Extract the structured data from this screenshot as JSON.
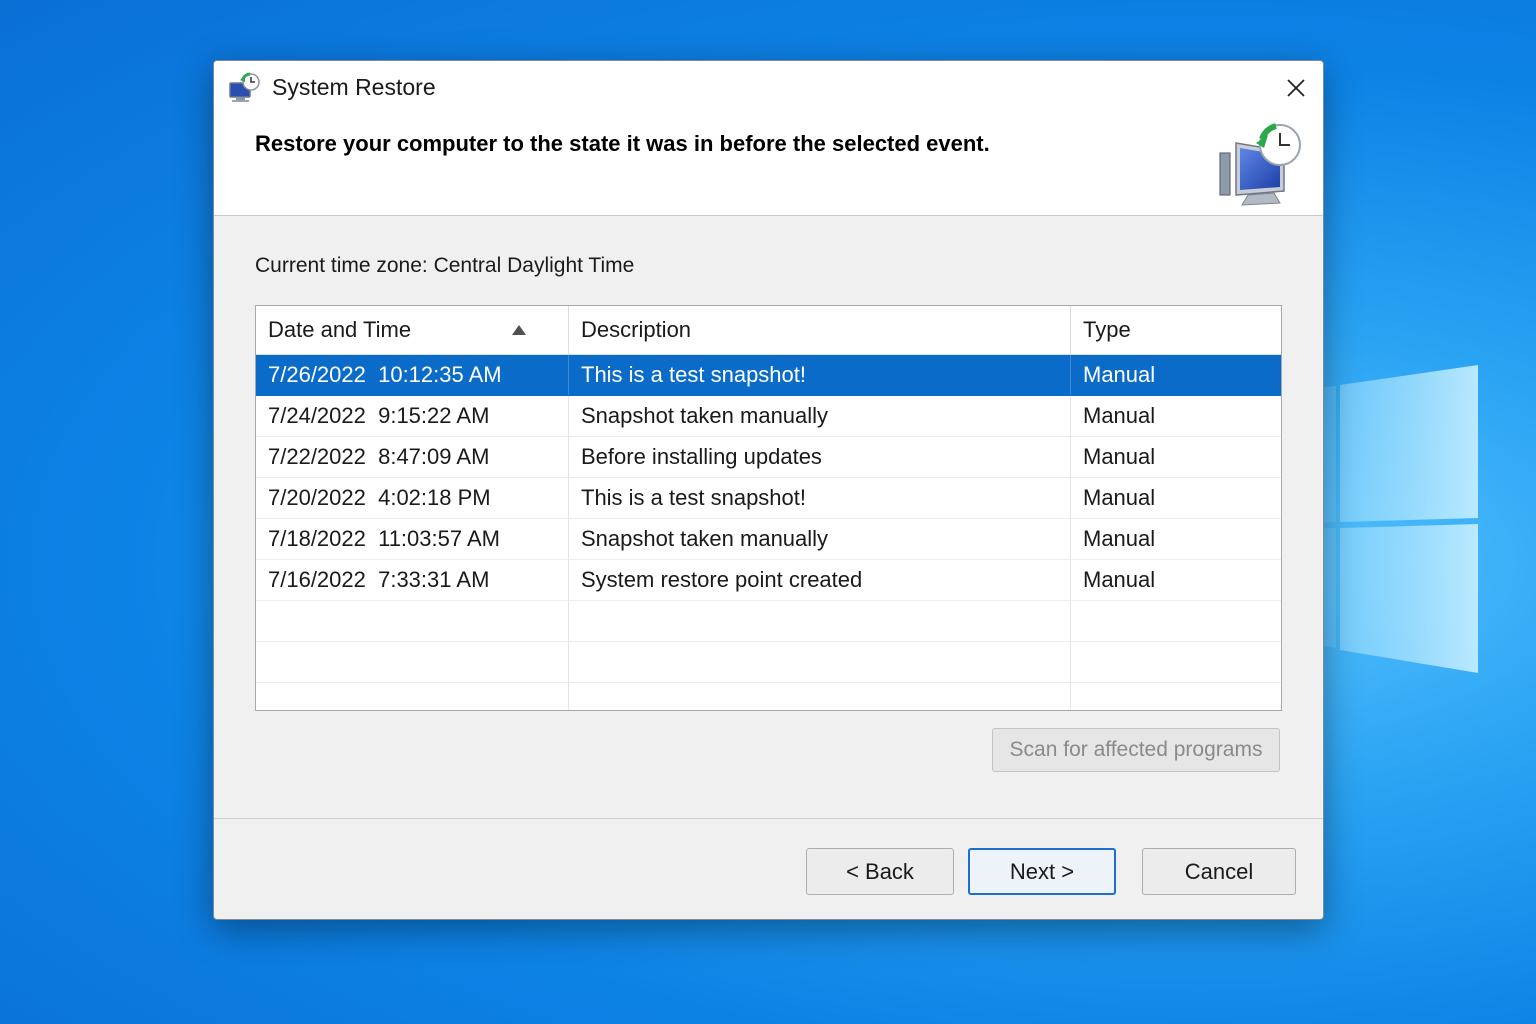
{
  "window": {
    "title": "System Restore",
    "heading": "Restore your computer to the state it was in before the selected event.",
    "timezone": "Current time zone: Central Daylight Time"
  },
  "table": {
    "columns": [
      "Date and Time",
      "Description",
      "Type"
    ],
    "sort_column": "Date and Time",
    "sort_direction": "ascending",
    "selected_row": 0,
    "rows": [
      {
        "date": "7/26/2022  10:12:35 AM",
        "description": "This is a test snapshot!",
        "type": "Manual"
      },
      {
        "date": "7/24/2022  9:15:22 AM",
        "description": "Snapshot taken manually",
        "type": "Manual"
      },
      {
        "date": "7/22/2022  8:47:09 AM",
        "description": "Before installing updates",
        "type": "Manual"
      },
      {
        "date": "7/20/2022  4:02:18 PM",
        "description": "This is a test snapshot!",
        "type": "Manual"
      },
      {
        "date": "7/18/2022  11:03:57 AM",
        "description": "Snapshot taken manually",
        "type": "Manual"
      },
      {
        "date": "7/16/2022  7:33:31 AM",
        "description": "System restore point created",
        "type": "Manual"
      }
    ]
  },
  "buttons": {
    "scan": "Scan for affected programs",
    "back": "< Back",
    "next": "Next >",
    "cancel": "Cancel"
  },
  "icons": {
    "title": "system-restore-icon",
    "close": "close-icon",
    "header_art": "restore-computer-clock-icon",
    "sort": "sort-ascending-icon"
  },
  "colors": {
    "selection": "#0a6cc8",
    "desktop": "#0d83e6",
    "default_button_border": "#1a6fd0"
  }
}
